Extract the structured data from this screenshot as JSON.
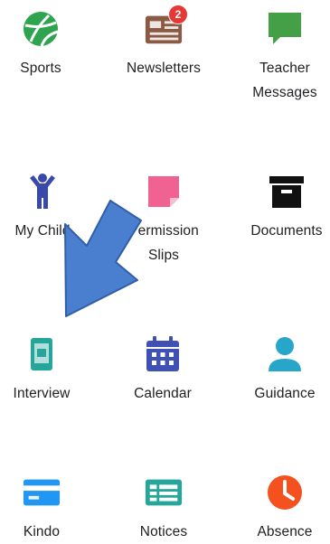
{
  "tiles": [
    {
      "label": "Sports",
      "icon": "sports-ball-icon",
      "color": "#2ea44f"
    },
    {
      "label": "Newsletters",
      "icon": "newspaper-icon",
      "color": "#8b5a45",
      "badge": "2"
    },
    {
      "label": "Teacher\nMessages",
      "icon": "chat-bubble-icon",
      "color": "#43a047"
    },
    {
      "label": "My Child",
      "icon": "child-icon",
      "color": "#3949ab"
    },
    {
      "label": "Permission\nSlips",
      "icon": "sticky-note-icon",
      "color": "#f06292"
    },
    {
      "label": "Documents",
      "icon": "archive-box-icon",
      "color": "#111111"
    },
    {
      "label": "Interview",
      "icon": "tablet-icon",
      "color": "#26a69a"
    },
    {
      "label": "Calendar",
      "icon": "calendar-icon",
      "color": "#3f51b5"
    },
    {
      "label": "Guidance",
      "icon": "person-icon",
      "color": "#26a7c9"
    },
    {
      "label": "Kindo",
      "icon": "credit-card-icon",
      "color": "#2196f3"
    },
    {
      "label": "Notices",
      "icon": "notice-board-icon",
      "color": "#26a69a"
    },
    {
      "label": "Absence",
      "icon": "clock-icon",
      "color": "#f4511e"
    }
  ],
  "overlay": {
    "icon": "pointer-arrow-icon",
    "color": "#4a7fd0"
  }
}
